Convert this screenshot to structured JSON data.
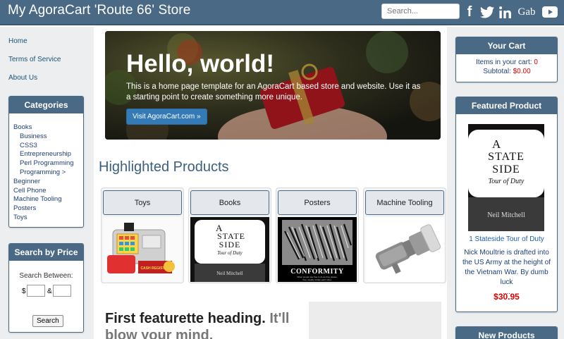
{
  "header": {
    "brand": "My AgoraCart 'Route 66' Store",
    "search_placeholder": "Search...",
    "social": {
      "facebook": "f",
      "gab": "Gab"
    }
  },
  "left_nav": {
    "links": [
      "Home",
      "Terms of Service",
      "About Us"
    ]
  },
  "categories": {
    "title": "Categories",
    "items": [
      {
        "label": "Books",
        "indent": 0
      },
      {
        "label": "Business",
        "indent": 1
      },
      {
        "label": "CSS3",
        "indent": 1
      },
      {
        "label": "Entrepreneurship",
        "indent": 1
      },
      {
        "label": "Perl Programming",
        "indent": 1
      },
      {
        "label": "Programming >",
        "indent": 1
      },
      {
        "label": "Beginner",
        "indent": 0
      },
      {
        "label": "Cell Phone",
        "indent": 0
      },
      {
        "label": "Machine Tooling",
        "indent": 0
      },
      {
        "label": "Posters",
        "indent": 0
      },
      {
        "label": "Toys",
        "indent": 0
      }
    ]
  },
  "search_by_price": {
    "title": "Search by Price",
    "between_label": "Search Between:",
    "currency": "$",
    "and": "&",
    "button": "Search"
  },
  "hero": {
    "title": "Hello, world!",
    "text": "This is a home page template for an AgoraCart based store and website. Use it as a starting point to create something more unique.",
    "button": "Visit AgoraCart.com »"
  },
  "highlighted": {
    "title": "Highlighted Products",
    "products": [
      {
        "label": "Toys"
      },
      {
        "label": "Books"
      },
      {
        "label": "Posters"
      },
      {
        "label": "Machine Tooling"
      }
    ]
  },
  "book_cover": {
    "line1": "A",
    "line2": "STATE",
    "line3": "SIDE",
    "subtitle": "Tour of Duty",
    "author": "Neil Mitchell"
  },
  "poster": {
    "word": "CONFORMITY",
    "caption1": "When people are free to do as they please,",
    "caption2": "they usually imitate each other."
  },
  "toy_label": "CASH REGISTER",
  "featurette": {
    "heading_main": "First featurette heading.",
    "heading_muted": "It'll blow your mind."
  },
  "cart": {
    "title": "Your Cart",
    "items_label": "Items in your cart:",
    "items_value": "0",
    "subtotal_label": "Subtotal:",
    "subtotal_value": "$0.00"
  },
  "featured": {
    "title": "Featured Product",
    "link": "1 Stateside Tour of Duty",
    "description": "Nick Moultrie is drafted into the US Army at the height of the Vietnam War. By dumb luck",
    "ellipsis": "....",
    "price": "$30.95"
  },
  "new_products": {
    "title": "New Products"
  },
  "colors": {
    "header": "#4a6985",
    "link": "#1a5276",
    "price": "#e00000"
  }
}
